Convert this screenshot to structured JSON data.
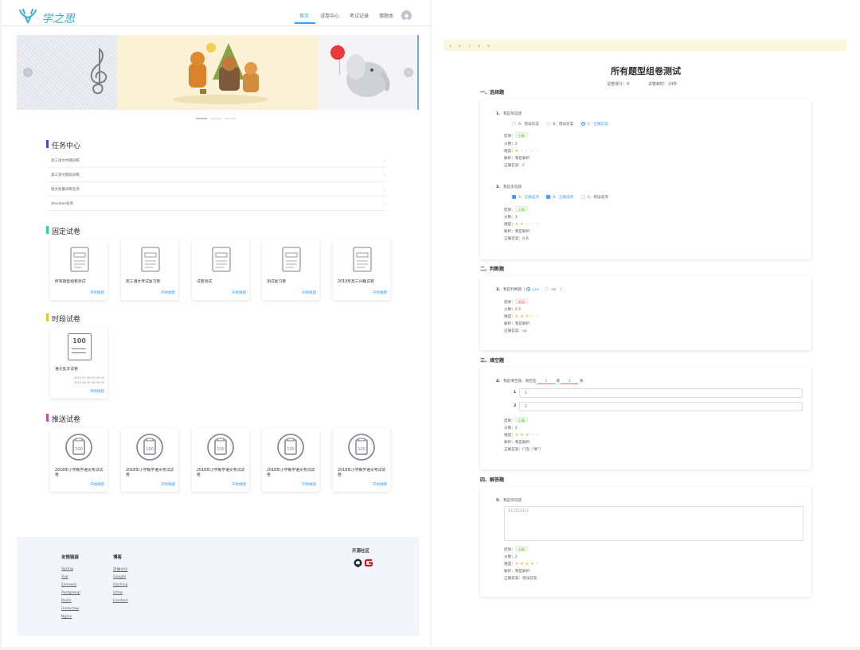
{
  "header": {
    "logo_text": "学之思",
    "nav": [
      "首页",
      "试卷中心",
      "考试记录",
      "错题本"
    ]
  },
  "sections": {
    "task": "任务中心",
    "fixed": "固定试卷",
    "timed": "时段试卷",
    "pushed": "推送试卷"
  },
  "tasks": [
    "高三语文中期训练",
    "高三语文期前训练",
    "语文轮番训练任务",
    "zhoubao任务"
  ],
  "fixed_papers": [
    "所有题型组卷测试",
    "高三语文考试复习卷",
    "试卷测试",
    "测试复习卷",
    "2019年高三兴趣试卷"
  ],
  "timed_papers": [
    {
      "title": "语文乱写试卷",
      "start": "2019-07-08 00:00:00",
      "end": "2019-08-30 00:00:00"
    }
  ],
  "pushed_papers": [
    "2018年小学数学语文考试试卷",
    "2018年小学数学语文考试试卷",
    "2018年小学数学语文考试试卷",
    "2018年小学数学语文考试试卷",
    "2018年小学数学语文考试试卷"
  ],
  "start_label": "开始做题",
  "timed_icon_text": "100",
  "footer": {
    "col1_title": "友情链接",
    "col1": [
      "Spring",
      "Vue",
      "Element",
      "Postgresql",
      "Redis",
      "Undertow",
      "Nginx"
    ],
    "col2_title": "博客",
    "col2": [
      "思维讨论",
      "Google",
      "Oschina",
      "Infoq",
      "Iconfont"
    ],
    "open_title": "开源社区"
  },
  "exam": {
    "pages": [
      "1",
      "2",
      "3",
      "4",
      "5"
    ],
    "title": "所有题型组卷测试",
    "score_label": "试卷得分：9",
    "time_label": "试卷耗时：24秒",
    "groups": [
      "一、选择题",
      "二、判断题",
      "三、填空题",
      "四、解答题"
    ],
    "labels": {
      "result": "结果：",
      "score": "分数：",
      "difficulty": "难度：",
      "analysis": "解析：",
      "answer": "正确答案："
    },
    "questions": {
      "q1": {
        "num": "1.",
        "text": "我是单选题",
        "options": [
          [
            "A.",
            "错误答案"
          ],
          [
            "B.",
            "错误答案"
          ],
          [
            "C.",
            "正确答案"
          ]
        ],
        "result": "正确",
        "score": "2",
        "difficulty": 1,
        "analysis": "我是解析",
        "answer": "C"
      },
      "q2": {
        "num": "2.",
        "text": "我是多选题",
        "options": [
          [
            "A.",
            "正确选项"
          ],
          [
            "B.",
            "正确选项"
          ],
          [
            "C.",
            "错误选项"
          ]
        ],
        "result": "正确",
        "score": "3",
        "difficulty": 2,
        "analysis": "我是解析",
        "answer": "A,B"
      },
      "q3": {
        "num": "3.",
        "text": "我是判断题（",
        "text_end": "）",
        "opt_yes": "yes",
        "opt_no": "no",
        "result": "错误",
        "score": "2.5",
        "difficulty": 3,
        "analysis": "我是解析",
        "answer": "no"
      },
      "q4": {
        "num": "4.",
        "text_a": "我是填空题。填空是",
        "blank1": "1",
        "text_b": "填",
        "blank2": "2",
        "text_c": "填",
        "inputs": [
          [
            "1",
            "1"
          ],
          [
            "2",
            "2"
          ]
        ],
        "result": "正确",
        "score": "2",
        "difficulty": 3,
        "analysis": "我是解析",
        "answer": "[\"选\",\"填\"]"
      },
      "q5": {
        "num": "5.",
        "text": "我是简答题",
        "textarea": "121312313",
        "result": "正确",
        "score": "2",
        "difficulty": 4,
        "analysis": "我是解析",
        "answer": "错误答案"
      }
    }
  },
  "colors": {
    "accent": "#409eff",
    "task_bar": "#3f51b5",
    "fixed_bar": "#2ed3a0",
    "timed_bar": "#e6c532",
    "pushed_bar": "#d44ca6",
    "pager_bg": "#f9f7dd"
  }
}
